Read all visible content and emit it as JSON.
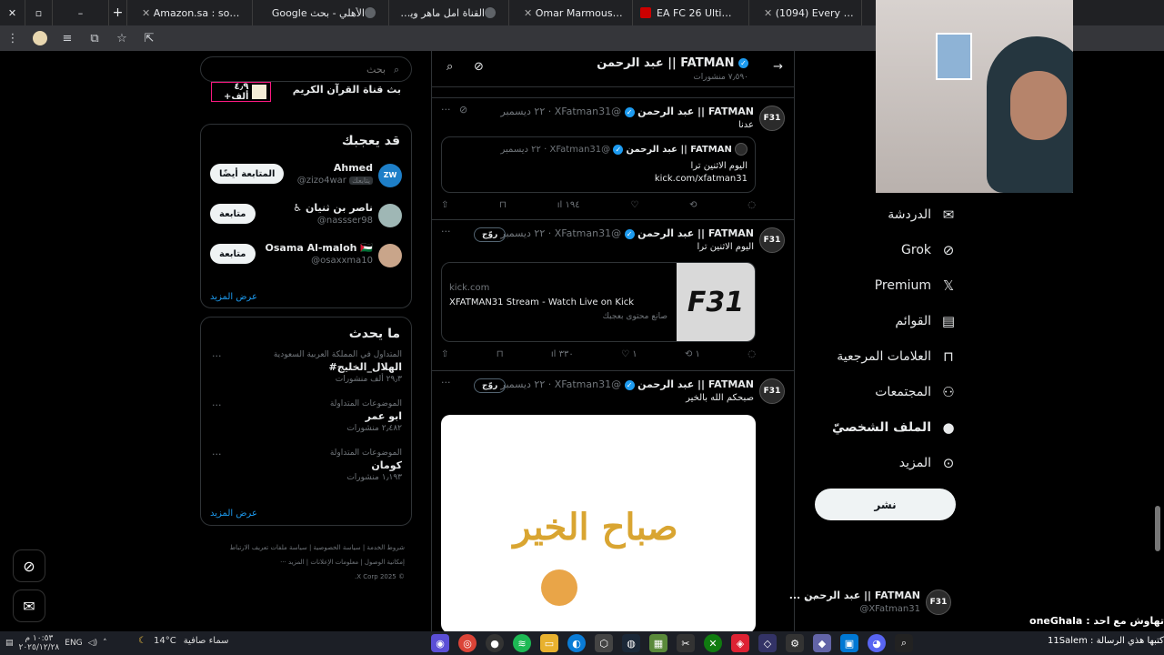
{
  "browser": {
    "tabs": [
      {
        "title": "Amazon.sa : sony alpha"
      },
      {
        "title": "الأهلي - بحث Google"
      },
      {
        "title": "القناة امل ماهر وين - بحث"
      },
      {
        "title": "Omar Marmoush Winter"
      },
      {
        "title": "EA FC 26 Ultimate Team"
      },
      {
        "title": "(1094) Every UFC Fighter"
      }
    ],
    "new_tab": "+"
  },
  "search": {
    "placeholder": "بحث"
  },
  "top_card": {
    "name": "بث قناة القرآن الكريم",
    "count": "٤٫٩ ألف+"
  },
  "who_to_follow": {
    "title": "قد يعجبك",
    "items": [
      {
        "name": "Ahmed",
        "handle": "@zizo4war",
        "badge": "يتابعك",
        "button": "المتابعة أيضًا",
        "avatar_color": "#1e7fc8",
        "avatar_text": "ZW"
      },
      {
        "name": "ناصر بن ثنيان ♿",
        "handle": "@nassser98",
        "badge": "",
        "button": "متابعة",
        "avatar_color": "#9fb7b5",
        "avatar_text": ""
      },
      {
        "name": "Osama Al-maloh 🇵🇸",
        "handle": "@osaxxma10",
        "badge": "",
        "button": "متابعة",
        "avatar_color": "#c9a58a",
        "avatar_text": ""
      }
    ],
    "show_more": "عرض المزيد"
  },
  "trends": {
    "title": "ما يحدث",
    "items": [
      {
        "meta": "المتداول في المملكة العربية السعودية",
        "topic": "#الهلال_الخليج",
        "posts": "٢٩٫٣ ألف منشورات"
      },
      {
        "meta": "الموضوعات المتداولة",
        "topic": "ابو عمر",
        "posts": "٢٫٤٨٢ منشورات"
      },
      {
        "meta": "الموضوعات المتداولة",
        "topic": "كومان",
        "posts": "١٫١٩٣ منشورات"
      }
    ],
    "show_more": "عرض المزيد"
  },
  "footer": {
    "links": [
      "شروط الخدمة",
      "سياسة الخصوصية",
      "سياسة ملفات تعريف الارتباط",
      "إمكانية الوصول",
      "معلومات الإعلانات",
      "المزيد ···"
    ],
    "copyright": "© 2025 X Corp."
  },
  "profile": {
    "name": "FATMAN || عبد الرحمن",
    "posts_count": "٧٫٥٩٠ منشورات",
    "handle": "@XFatman31",
    "avatar_text": "F31"
  },
  "posts": [
    {
      "name": "FATMAN || عبد الرحمن",
      "handle": "@XFatman31",
      "date": "٢٢ ديسمبر",
      "text": "عدنا",
      "quote": {
        "name": "FATMAN || عبد الرحمن",
        "handle": "@XFatman31",
        "date": "٢٢ ديسمبر",
        "line1": "اليوم الاثنين ترا",
        "line2": "kick.com/xfatman31"
      },
      "actions": {
        "reply": "",
        "repost": "",
        "like": "",
        "views": "١٩٤"
      }
    },
    {
      "name": "FATMAN || عبد الرحمن",
      "handle": "@XFatman31",
      "date": "٢٢ ديسمبر",
      "text": "اليوم الاثنين ترا",
      "translate": "روّج",
      "card": {
        "domain": "kick.com",
        "title": "XFATMAN31 Stream - Watch Live on Kick",
        "desc": "صانع محتوى بعجبك",
        "image_text": "F31"
      },
      "actions": {
        "reply": "",
        "repost": "١",
        "like": "١",
        "views": "٣٣٠"
      }
    },
    {
      "name": "FATMAN || عبد الرحمن",
      "handle": "@XFatman31",
      "date": "٢٢ ديسمبر",
      "text": "صبحكم الله بالخير",
      "translate": "روّج",
      "media_text": "صباح الخير"
    }
  ],
  "nav": {
    "items": [
      {
        "label": "الدردشة",
        "icon": "mail-icon"
      },
      {
        "label": "Grok",
        "icon": "grok-icon"
      },
      {
        "label": "Premium",
        "icon": "x-logo-icon"
      },
      {
        "label": "القوائم",
        "icon": "list-icon"
      },
      {
        "label": "العلامات المرجعية",
        "icon": "bookmark-icon"
      },
      {
        "label": "المجتمعات",
        "icon": "communities-icon"
      },
      {
        "label": "الملف الشخصيّ",
        "icon": "profile-icon"
      },
      {
        "label": "المزيد",
        "icon": "more-circle-icon"
      }
    ],
    "post_button": "نشر"
  },
  "account": {
    "name": "FATMAN || عبد الرحمن ...",
    "handle": "@XFatman31",
    "avatar_text": "F31"
  },
  "stream_chat": {
    "line1": "تهاوش مع احد : oneGhala",
    "line2": "اكتبها هذي الرسالة : 11Salem"
  },
  "taskbar": {
    "weather_temp": "14°C",
    "weather_desc": "سماء صافية",
    "time": "١٠:٥٣ م",
    "date": "٢٠٢٥/١٢/٢٨",
    "lang": "ENG"
  },
  "colors": {
    "accent": "#1d9bf0",
    "background": "#000000",
    "border": "#2f3336"
  }
}
